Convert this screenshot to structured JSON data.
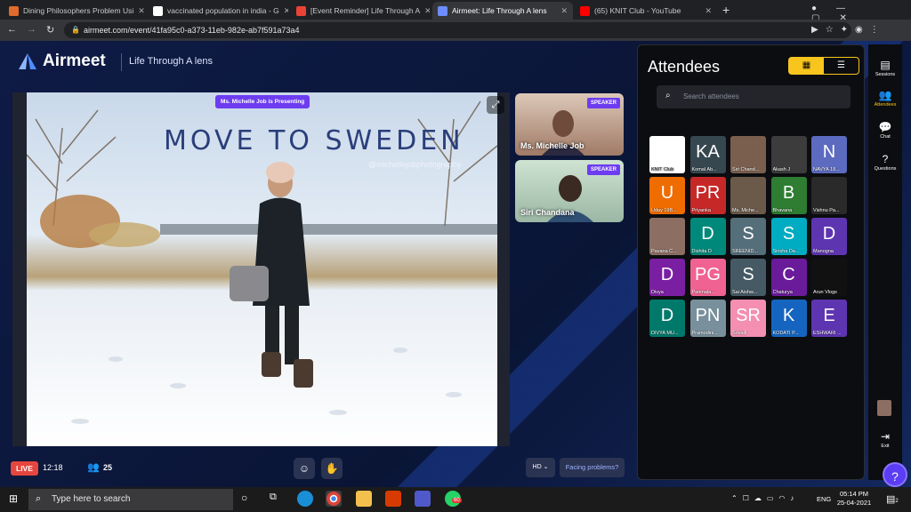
{
  "browser": {
    "tabs": [
      {
        "title": "Dining Philosophers Problem Usi",
        "favicon_color": "#e06b2c",
        "active": false
      },
      {
        "title": "vaccinated population in india - G",
        "favicon_color": "#ffffff",
        "active": false
      },
      {
        "title": "[Event Reminder] Life Through A",
        "favicon_color": "#ea4335",
        "active": false
      },
      {
        "title": "Airmeet: Life Through A lens",
        "favicon_color": "#6c8cff",
        "active": true
      },
      {
        "title": "(65) KNIT Club - YouTube",
        "favicon_color": "#ff0000",
        "active": false
      }
    ],
    "url": "airmeet.com/event/41fa95c0-a373-11eb-982e-ab7f591a73a4"
  },
  "header": {
    "logo": "Airmeet",
    "event_title": "Life Through A lens"
  },
  "stage": {
    "presenting_badge": "Ms. Michelle Job is Presenting",
    "slide_title": "MOVE TO SWEDEN",
    "watermark": "@michellejobphotography"
  },
  "speakers": [
    {
      "name": "Ms. Michelle Job",
      "badge": "SPEAKER"
    },
    {
      "name": "Siri Chandana",
      "badge": "SPEAKER"
    }
  ],
  "bottombar": {
    "live": "LIVE",
    "timer": "12:18",
    "attendee_count": "25",
    "quality": "HD",
    "facing": "Facing problems?"
  },
  "attendees": {
    "title": "Attendees",
    "search_placeholder": "Search attendees",
    "list": [
      {
        "initials": "",
        "label": "KNIT Club",
        "color": "#ffffff"
      },
      {
        "initials": "KA",
        "label": "Komal Ab...",
        "color": "#37474f"
      },
      {
        "initials": "",
        "label": "Siri Chand...",
        "color": "#7a5f4e"
      },
      {
        "initials": "",
        "label": "Akash J",
        "color": "#3c3c3c"
      },
      {
        "initials": "N",
        "label": "NAVYA 18...",
        "color": "#5c6bc0"
      },
      {
        "initials": "U",
        "label": "Uday 19B...",
        "color": "#ef6c00"
      },
      {
        "initials": "PR",
        "label": "Priyanka",
        "color": "#c62828"
      },
      {
        "initials": "",
        "label": "Ms. Miche...",
        "color": "#6b5a4a"
      },
      {
        "initials": "B",
        "label": "Bhavana",
        "color": "#2e7d32"
      },
      {
        "initials": "",
        "label": "Vishnu Pa...",
        "color": "#2a2a2a"
      },
      {
        "initials": "",
        "label": "Pavana C...",
        "color": "#8d6e63"
      },
      {
        "initials": "D",
        "label": "Dishita D",
        "color": "#00897b"
      },
      {
        "initials": "S",
        "label": "SREENID...",
        "color": "#546e7a"
      },
      {
        "initials": "S",
        "label": "Sirisha Da...",
        "color": "#00acc1"
      },
      {
        "initials": "D",
        "label": "Manogna",
        "color": "#5e35b1"
      },
      {
        "initials": "D",
        "label": "Divya",
        "color": "#7b1fa2"
      },
      {
        "initials": "PG",
        "label": "Parimala ...",
        "color": "#f06292"
      },
      {
        "initials": "S",
        "label": "Sai Aishw...",
        "color": "#455a64"
      },
      {
        "initials": "C",
        "label": "Chaturya",
        "color": "#6a1b9a"
      },
      {
        "initials": "",
        "label": "Arun Vlogs",
        "color": "#111111"
      },
      {
        "initials": "D",
        "label": "DIVYA MU...",
        "color": "#00796b"
      },
      {
        "initials": "PN",
        "label": "Pramodini...",
        "color": "#78909c"
      },
      {
        "initials": "SR",
        "label": "Srivalli",
        "color": "#f48fb1"
      },
      {
        "initials": "K",
        "label": "KODATI P...",
        "color": "#1565c0"
      },
      {
        "initials": "E",
        "label": "ESHWARI ...",
        "color": "#5e35b1"
      }
    ]
  },
  "rail": [
    {
      "label": "Sessions",
      "icon": "sessions-icon"
    },
    {
      "label": "Attendees",
      "icon": "people-icon"
    },
    {
      "label": "Chat",
      "icon": "chat-icon"
    },
    {
      "label": "Questions",
      "icon": "question-icon"
    },
    {
      "label": "Exit",
      "icon": "exit-icon"
    }
  ],
  "taskbar": {
    "search_placeholder": "Type here to search",
    "lang": "ENG",
    "time": "05:14 PM",
    "date": "25-04-2021",
    "whatsapp_badge": "60",
    "notif_badge": "2"
  }
}
